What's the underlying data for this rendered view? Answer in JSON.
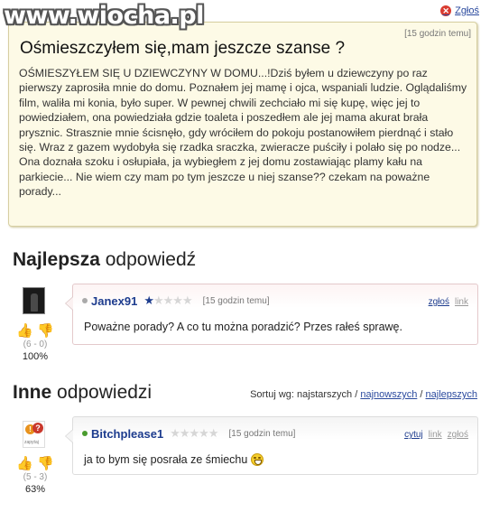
{
  "watermark": "www.wiocha.pl",
  "top_report": {
    "icon": "close-icon",
    "label": "Zgłoś"
  },
  "question": {
    "time": "[15 godzin temu]",
    "title": "Ośmieszczyłem się,mam jeszcze szanse ?",
    "body": "OŚMIESZYŁEM SIĘ U DZIEWCZYNY W DOMU...!Dziś byłem u dziewczyny po raz pierwszy zaprosiła mnie do domu. Poznałem jej mamę i ojca, wspaniali ludzie. Oglądaliśmy film, waliła mi konia, było super. W pewnej chwili zechciało mi się kupę, więc jej to powiedziałem, ona powiedziała gdzie toaleta i poszedłem ale jej mama akurat brała prysznic. Strasznie mnie ścisnęło, gdy wróciłem do pokoju postanowiłem pierdnąć i stało się. Wraz z gazem wydobyła się rzadka sraczka, zwieracze puściły i polało się po nodze... Ona doznała szoku i osłupiała, ja wybiegłem z jej domu zostawiając plamy kału na parkiecie... Nie wiem czy mam po tym jeszcze u niej szanse?? czekam na poważne porady..."
  },
  "best_section": {
    "bold": "Najlepsza",
    "rest": "odpowiedź"
  },
  "other_section": {
    "bold": "Inne",
    "rest": "odpowiedzi"
  },
  "sort": {
    "prefix": "Sortuj wg: najstarszych /",
    "option_newest": "najnowszych",
    "separator": "/",
    "option_best": "najlepszych"
  },
  "answers": [
    {
      "username": "Janex91",
      "stars_filled": 1,
      "stars_total": 5,
      "time": "[15 godzin temu]",
      "links": [
        "zgłoś",
        "link"
      ],
      "text": "Poważne porady? A co tu można poradzić? Przes rałeś sprawę.",
      "votes": "(6 - 0)",
      "percent": "100%",
      "status_color": "#aaaaaa"
    },
    {
      "username": "Bitchplease1",
      "stars_filled": 0,
      "stars_total": 5,
      "time": "[15 godzin temu]",
      "links": [
        "cytuj",
        "link",
        "zgłoś"
      ],
      "text": "ja to bym się posrała ze śmiechu",
      "votes": "(5 - 3)",
      "percent": "63%",
      "status_color": "#4a9c2e",
      "emoticon": "grin-smiley-icon"
    }
  ],
  "colors": {
    "username": "#1d3c8e",
    "question_bg": "#fdfae6",
    "thumb_up": "#c4449a",
    "thumb_down": "#d9a520"
  }
}
